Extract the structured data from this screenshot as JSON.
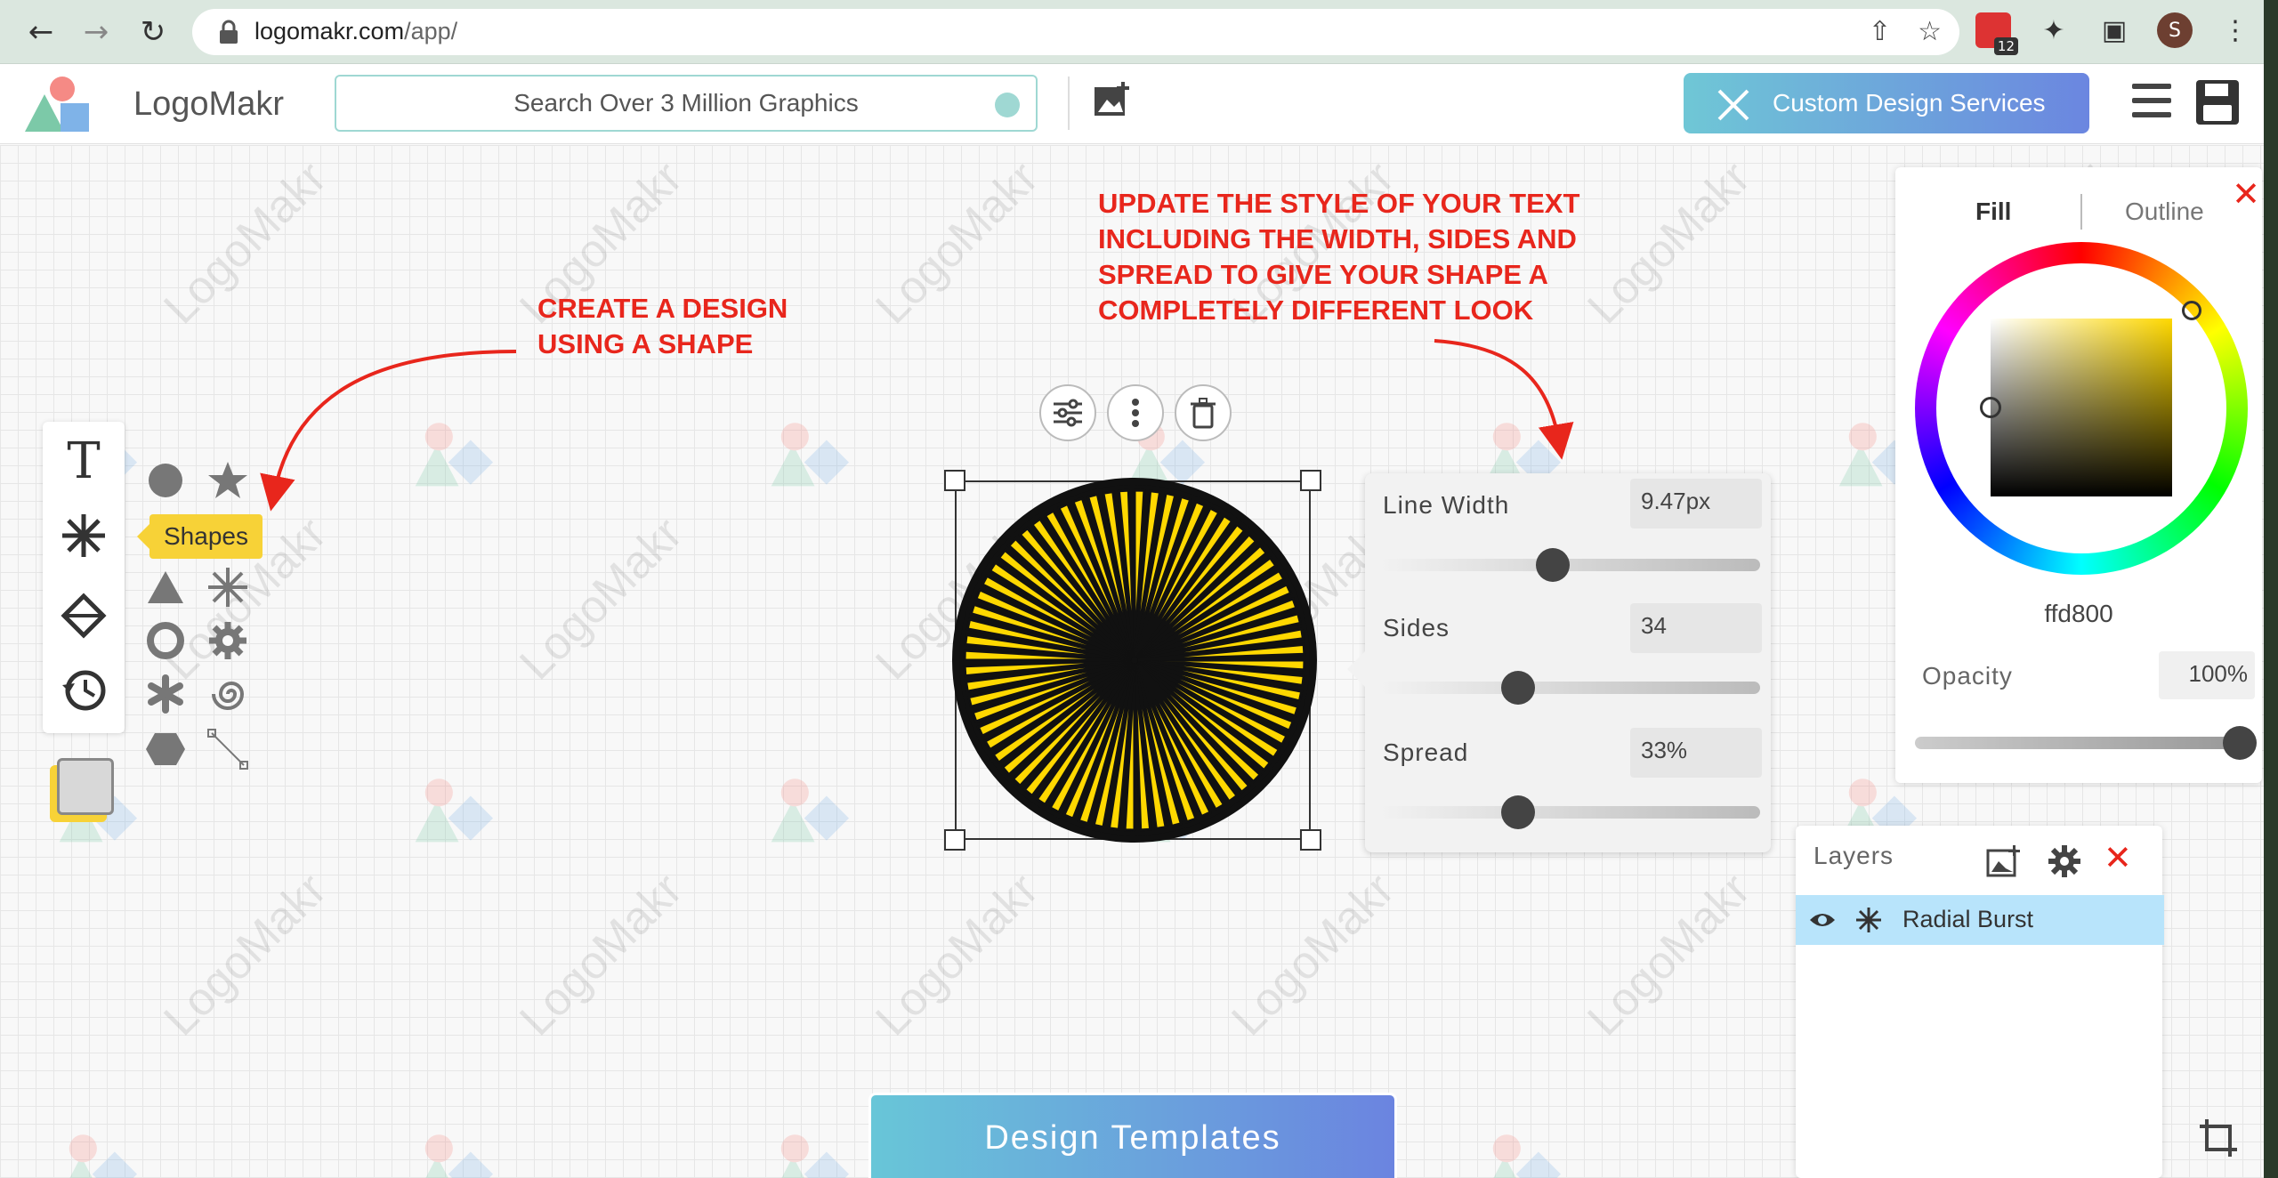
{
  "browser": {
    "url_host": "logomakr.com",
    "url_path": "/app/",
    "ext_badge": "12",
    "profile_initial": "S"
  },
  "header": {
    "brand": "LogoMakr",
    "search_placeholder": "Search Over 3 Million Graphics",
    "custom_design_label": "Custom Design Services"
  },
  "canvas": {
    "watermark_text": "LogoMakr"
  },
  "toolbar": {
    "text_tool_glyph": "T",
    "shapes_tooltip": "Shapes"
  },
  "annotations": {
    "note_left": [
      "CREATE A DESIGN",
      "USING A SHAPE"
    ],
    "note_right": [
      "UPDATE THE STYLE OF YOUR TEXT",
      "INCLUDING THE WIDTH, SIDES AND",
      "SPREAD TO GIVE YOUR SHAPE A",
      "COMPLETELY DIFFERENT LOOK"
    ]
  },
  "shape_settings": {
    "line_width_label": "Line Width",
    "line_width_value": "9.47px",
    "line_width_slider": 0.45,
    "sides_label": "Sides",
    "sides_value": "34",
    "sides_slider": 0.35,
    "spread_label": "Spread",
    "spread_value": "33%",
    "spread_slider": 0.35
  },
  "color_panel": {
    "tab_fill": "Fill",
    "tab_outline": "Outline",
    "hex": "ffd800",
    "opacity_label": "Opacity",
    "opacity_value": "100%",
    "opacity_level": 1.0,
    "fill_color": "#ffd800"
  },
  "layers": {
    "title": "Layers",
    "items": [
      {
        "name": "Radial Burst"
      }
    ]
  },
  "footer": {
    "templates_label": "Design Templates"
  },
  "colors": {
    "accent_red": "#e8261c",
    "tooltip_yellow": "#f7d237",
    "layer_selected": "#b8e4fb"
  }
}
